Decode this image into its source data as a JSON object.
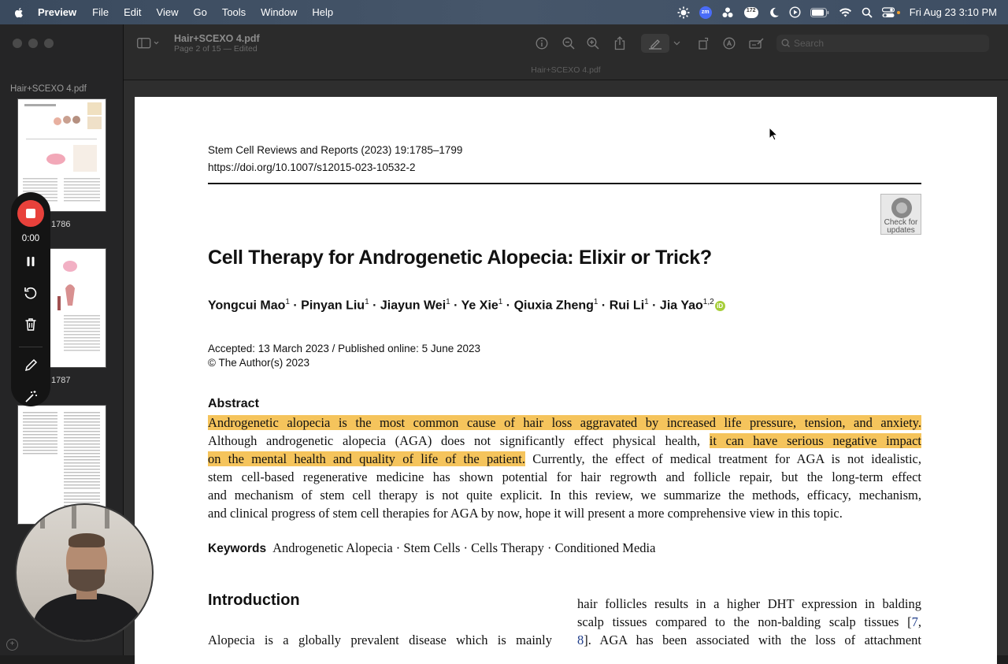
{
  "menubar": {
    "app": "Preview",
    "items": [
      "File",
      "Edit",
      "View",
      "Go",
      "Tools",
      "Window",
      "Help"
    ],
    "zoom_badge": "zm",
    "notif_count": "172",
    "datetime": "Fri Aug 23  3:10 PM"
  },
  "sidebar": {
    "title": "Hair+SCEXO 4.pdf",
    "page_labels": [
      "1786",
      "1787"
    ]
  },
  "toolbar": {
    "doc_title": "Hair+SCEXO 4.pdf",
    "doc_subtitle": "Page 2 of 15 — Edited",
    "tab_name": "Hair+SCEXO 4.pdf",
    "search_placeholder": "Search"
  },
  "recorder": {
    "time": "0:00"
  },
  "page": {
    "journal": "Stem Cell Reviews and Reports (2023) 19:1785–1799",
    "doi": "https://doi.org/10.1007/s12015-023-10532-2",
    "check_updates": "Check for updates",
    "title": "Cell Therapy for Androgenetic Alopecia: Elixir or Trick?",
    "authors": [
      {
        "name": "Yongcui Mao",
        "sup": "1"
      },
      {
        "name": "Pinyan Liu",
        "sup": "1"
      },
      {
        "name": "Jiayun Wei",
        "sup": "1"
      },
      {
        "name": "Ye Xie",
        "sup": "1"
      },
      {
        "name": "Qiuxia Zheng",
        "sup": "1"
      },
      {
        "name": "Rui Li",
        "sup": "1"
      },
      {
        "name": "Jia Yao",
        "sup": "1,2"
      }
    ],
    "author_sep": " · ",
    "orcid": "iD",
    "accepted": "Accepted: 13 March 2023 / Published online: 5 June 2023",
    "copyright": "© The Author(s) 2023",
    "abstract_heading": "Abstract",
    "abstract": {
      "l1": "Androgenetic alopecia is the most common cause of hair loss aggravated by increased life pressure, tension, and anxiety.",
      "l2a": "Although androgenetic alopecia (AGA) does not significantly effect physical health, ",
      "l2b": "it can have serious negative impact",
      "l3a": "on the mental health and quality of life of the patient.",
      "l3b": " Currently, the effect of medical treatment for AGA is not idealistic,",
      "l4": "stem cell-based regenerative medicine has shown potential for hair regrowth and follicle repair, but the long-term effect",
      "l5": "and mechanism of stem cell therapy is not quite explicit. In this review, we summarize the methods, efficacy, mechanism,",
      "l6": "and clinical progress of stem cell therapies for AGA by now, hope it will present a more comprehensive view in this topic."
    },
    "keywords_label": "Keywords",
    "keywords": "Androgenetic Alopecia · Stem Cells · Cells Therapy · Conditioned Media",
    "intro_heading": "Introduction",
    "left_col": "Alopecia is a globally prevalent disease which is mainly",
    "right_col": {
      "l1": "hair follicles results in a higher DHT expression in balding",
      "l2a": "scalp tissues compared to the non-balding scalp tissues [",
      "l2link": "7",
      "l2b": ",",
      "l3link": "8",
      "l3b": "]. AGA has been associated with the loss of attachment"
    }
  }
}
